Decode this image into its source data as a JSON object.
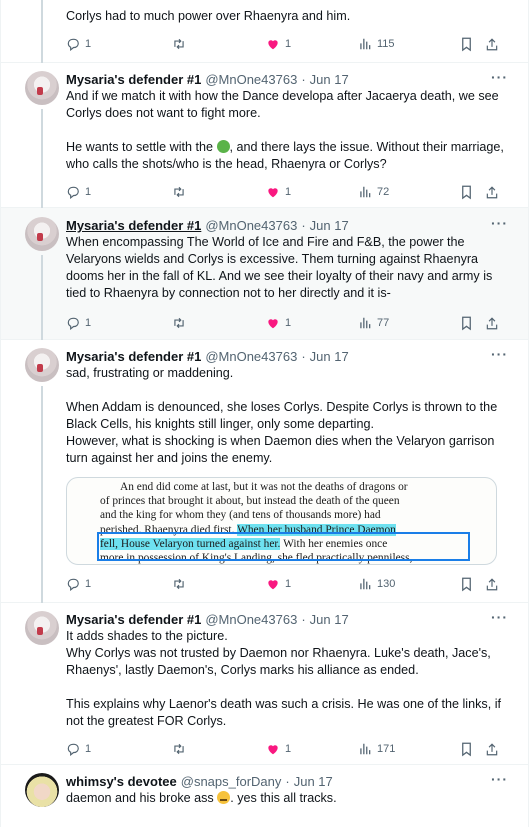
{
  "colors": {
    "like": "#f91880",
    "muted": "#536471",
    "highlight_box": "#1a7ee8",
    "highlight_fill": "#6ee1f0"
  },
  "tweet0": {
    "text": "Corlys had to much power over Rhaenyra and him.",
    "replies": "1",
    "likes": "1",
    "views": "115"
  },
  "tweet1": {
    "name": "Mysaria's defender #1",
    "handle": "@MnOne43763",
    "dot": "·",
    "date": "Jun 17",
    "p1": "And if we match it with how the Dance developa after Jacaerya death, we see Corlys does not want to fight more.",
    "p2a": "He wants to settle with the ",
    "p2b": ", and there lays the issue. Without their marriage, who calls the shots/who is the head, Rhaenyra or Corlys?",
    "replies": "1",
    "likes": "1",
    "views": "72"
  },
  "tweet2": {
    "name": "Mysaria's defender #1",
    "handle": "@MnOne43763",
    "dot": "·",
    "date": "Jun 17",
    "p1": "When encompassing The World of Ice and Fire and F&B, the power the Velaryons wields and Corlys is excessive. Them turning against Rhaenyra dooms her in the fall of KL. And we see their loyalty of their navy and army is tied to Rhaenyra by connection not to her directly and it is-",
    "replies": "1",
    "likes": "1",
    "views": "77"
  },
  "tweet3": {
    "name": "Mysaria's defender #1",
    "handle": "@MnOne43763",
    "dot": "·",
    "date": "Jun 17",
    "p1": "sad, frustrating or maddening.",
    "p2": "When Addam is denounced, she loses Corlys. Despite Corlys is thrown to the Black Cells, his knights still linger, only some departing.\nHowever, what is shocking is when Daemon dies when the Velaryon garrison turn against her and joins the enemy.",
    "book": {
      "l1": "An end did come at last, but it was not the deaths of dragons or",
      "l2": "of princes that brought it about, but instead the death of the queen",
      "l3": "and the king for whom they (and tens of thousands more) had",
      "l4a": "perished. Rhaenyra died first. ",
      "l4b": "When her husband Prince Daemon",
      "l5a": "fell, House Velaryon turned against her.",
      "l5b": " With her enemies once",
      "l6": "more in possession of King's Landing, she fled practically penniless,"
    },
    "replies": "1",
    "likes": "1",
    "views": "130"
  },
  "tweet4": {
    "name": "Mysaria's defender #1",
    "handle": "@MnOne43763",
    "dot": "·",
    "date": "Jun 17",
    "p1": "It adds shades to the picture.\nWhy Corlys was not trusted by Daemon nor Rhaenyra. Luke's death, Jace's, Rhaenys', lastly Daemon's, Corlys marks his alliance as ended.",
    "p2": "This explains why Laenor's death was such a crisis. He was one of the links, if not the greatest FOR Corlys.",
    "replies": "1",
    "likes": "1",
    "views": "171"
  },
  "tweet5": {
    "name": "whimsy's devotee",
    "handle": "@snaps_forDany",
    "dot": "·",
    "date": "Jun 17",
    "p1a": "daemon and his broke ass ",
    "p1b": ". yes this all tracks."
  },
  "icons": {
    "reply": "reply-icon",
    "retweet": "retweet-icon",
    "like": "heart-icon",
    "views": "views-icon",
    "bookmark": "bookmark-icon",
    "share": "share-icon",
    "more": "more-icon"
  }
}
